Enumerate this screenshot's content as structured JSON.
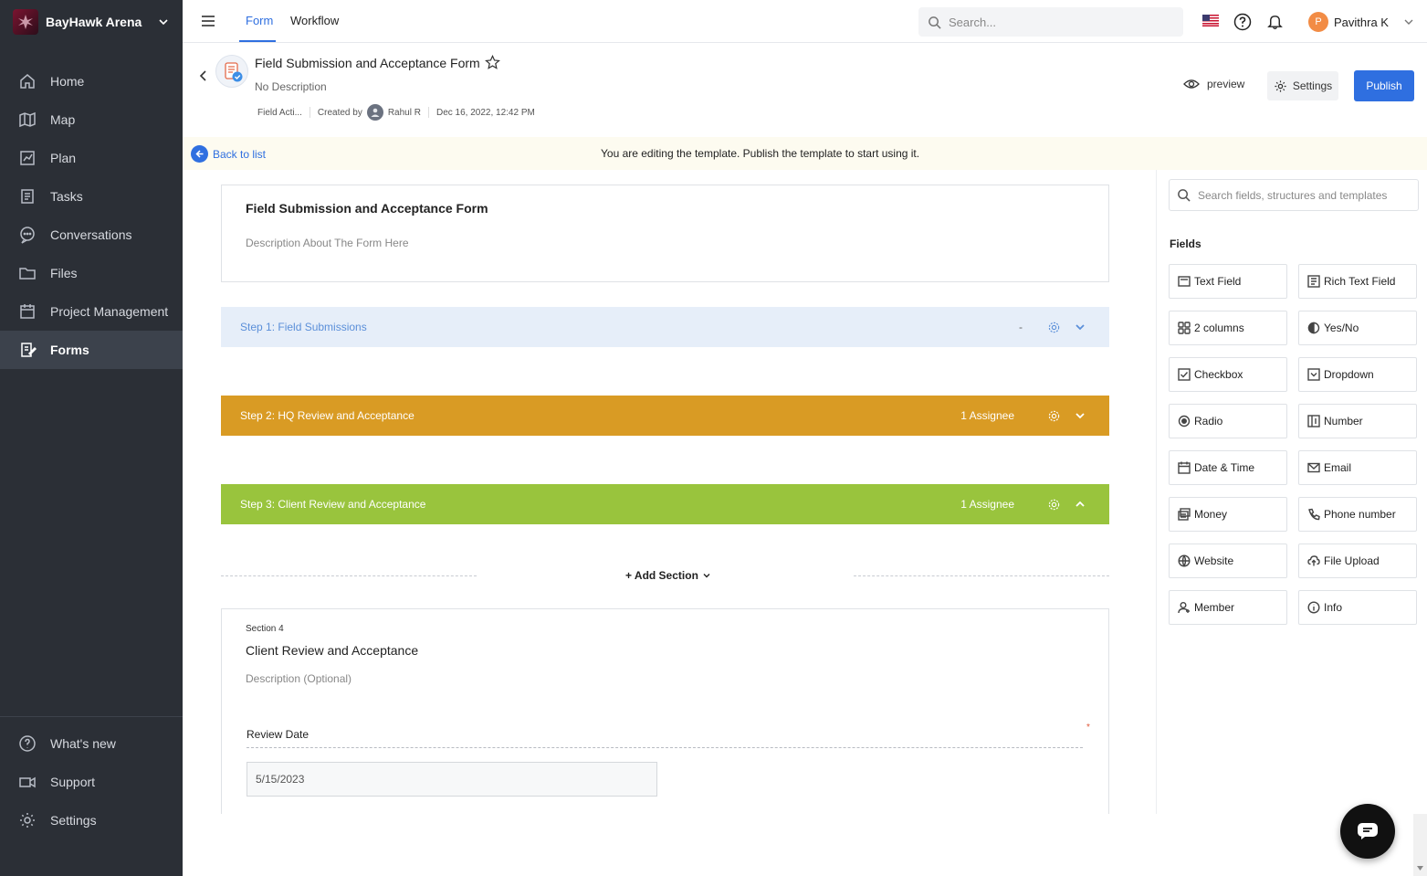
{
  "brand": {
    "name": "BayHawk Arena"
  },
  "sidebar": {
    "items": [
      {
        "label": "Home",
        "icon": "home-icon"
      },
      {
        "label": "Map",
        "icon": "map-icon"
      },
      {
        "label": "Plan",
        "icon": "plan-icon"
      },
      {
        "label": "Tasks",
        "icon": "tasks-icon"
      },
      {
        "label": "Conversations",
        "icon": "conversations-icon"
      },
      {
        "label": "Files",
        "icon": "folder-icon"
      },
      {
        "label": "Project Management",
        "icon": "calendar-icon"
      },
      {
        "label": "Forms",
        "icon": "forms-icon",
        "active": true
      }
    ],
    "bottom_items": [
      {
        "label": "What's new",
        "icon": "help-circle-icon"
      },
      {
        "label": "Support",
        "icon": "video-icon"
      },
      {
        "label": "Settings",
        "icon": "gear-icon"
      }
    ]
  },
  "topbar": {
    "tabs": [
      {
        "label": "Form",
        "active": true
      },
      {
        "label": "Workflow"
      }
    ],
    "search_placeholder": "Search...",
    "user": {
      "initial": "P",
      "name": "Pavithra K"
    }
  },
  "header": {
    "title": "Field Submission and Acceptance Form",
    "description": "No Description",
    "category": "Field Acti...",
    "created_by_label": "Created by",
    "creator": "Rahul R",
    "created_at": "Dec 16, 2022, 12:42 PM",
    "preview_label": "preview",
    "settings_label": "Settings",
    "publish_label": "Publish"
  },
  "notice": {
    "back_label": "Back to list",
    "message": "You are editing the template. Publish the template to start using it."
  },
  "form": {
    "title": "Field Submission and Acceptance Form",
    "description_placeholder": "Description About The Form Here",
    "steps": [
      {
        "label": "Step 1:  Field Submissions",
        "assignee": "-",
        "expanded": false,
        "color": "#e6eef9"
      },
      {
        "label": "Step 2:  HQ Review and Acceptance",
        "assignee": "1 Assignee",
        "expanded": false,
        "color": "#d99b24"
      },
      {
        "label": "Step 3:  Client Review and Acceptance",
        "assignee": "1 Assignee",
        "expanded": true,
        "color": "#99c43d"
      }
    ],
    "add_section_label": "+ Add Section",
    "section": {
      "number": "Section 4",
      "title": "Client Review and Acceptance",
      "description_placeholder": "Description (Optional)",
      "field_label": "Review Date",
      "required_mark": "*",
      "date_value": "5/15/2023"
    }
  },
  "panel": {
    "search_placeholder": "Search fields, structures and templates",
    "fields_title": "Fields",
    "fields": [
      {
        "label": "Text Field",
        "icon": "text-field-icon"
      },
      {
        "label": "Rich Text Field",
        "icon": "rich-text-icon"
      },
      {
        "label": "2 columns",
        "icon": "columns-icon"
      },
      {
        "label": "Yes/No",
        "icon": "yes-no-icon"
      },
      {
        "label": "Checkbox",
        "icon": "checkbox-icon"
      },
      {
        "label": "Dropdown",
        "icon": "dropdown-icon"
      },
      {
        "label": "Radio",
        "icon": "radio-icon"
      },
      {
        "label": "Number",
        "icon": "number-icon"
      },
      {
        "label": "Date & Time",
        "icon": "calendar-icon"
      },
      {
        "label": "Email",
        "icon": "email-icon"
      },
      {
        "label": "Money",
        "icon": "money-icon"
      },
      {
        "label": "Phone number",
        "icon": "phone-icon"
      },
      {
        "label": "Website",
        "icon": "globe-icon"
      },
      {
        "label": "File Upload",
        "icon": "upload-icon"
      },
      {
        "label": "Member",
        "icon": "member-icon"
      },
      {
        "label": "Info",
        "icon": "info-icon"
      }
    ]
  }
}
